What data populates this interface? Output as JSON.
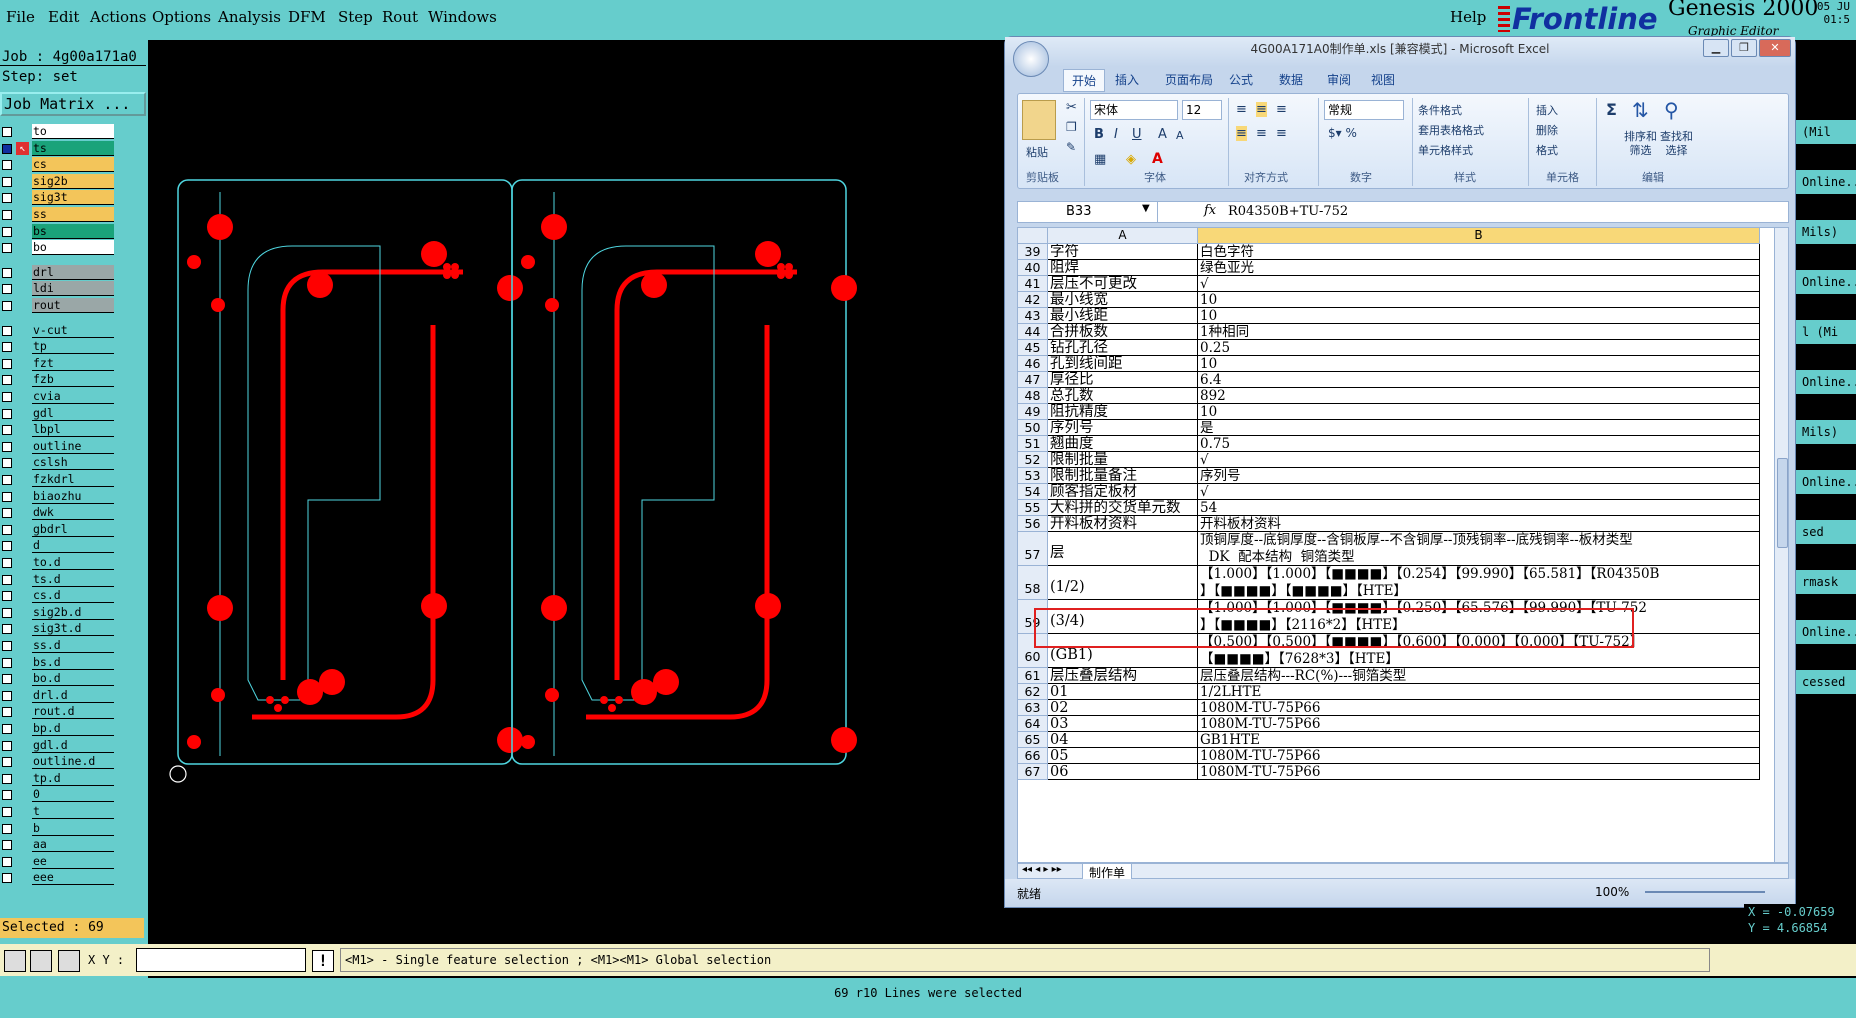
{
  "menu": {
    "items": [
      "File",
      "Edit",
      "Actions",
      "Options",
      "Analysis",
      "DFM",
      "Step",
      "Rout",
      "Windows"
    ],
    "help": "Help"
  },
  "brand": {
    "logo": "Frontline",
    "product": "Genesis 2000",
    "subtitle": "Graphic Editor",
    "date": "05 JU",
    "time": "01:5"
  },
  "job": {
    "job_line": "Job : 4g00a171a0",
    "step_line": "Step: set",
    "matrix_button": "Job Matrix ..."
  },
  "layers": [
    {
      "name": "to",
      "color": "#ffffff",
      "checked": false
    },
    {
      "name": "ts",
      "color": "#1aa37a",
      "checked": true
    },
    {
      "name": "cs",
      "color": "#f3c55a",
      "checked": false
    },
    {
      "name": "sig2b",
      "color": "#f3c55a",
      "checked": false
    },
    {
      "name": "sig3t",
      "color": "#f3c55a",
      "checked": false
    },
    {
      "name": "ss",
      "color": "#f3c55a",
      "checked": false
    },
    {
      "name": "bs",
      "color": "#1aa37a",
      "checked": false
    },
    {
      "name": "bo",
      "color": "#ffffff",
      "checked": false
    },
    {
      "name": "drl",
      "color": "#9aa7a7",
      "checked": false
    },
    {
      "name": "ldi",
      "color": "#9aa7a7",
      "checked": false
    },
    {
      "name": "rout",
      "color": "#9aa7a7",
      "checked": false
    },
    {
      "name": "v-cut",
      "color": "#66cdcc",
      "checked": false
    },
    {
      "name": "tp",
      "color": "#66cdcc",
      "checked": false
    },
    {
      "name": "fzt",
      "color": "#66cdcc",
      "checked": false
    },
    {
      "name": "fzb",
      "color": "#66cdcc",
      "checked": false
    },
    {
      "name": "cvia",
      "color": "#66cdcc",
      "checked": false
    },
    {
      "name": "gdl",
      "color": "#66cdcc",
      "checked": false
    },
    {
      "name": "lbpl",
      "color": "#66cdcc",
      "checked": false
    },
    {
      "name": "outline",
      "color": "#66cdcc",
      "checked": false
    },
    {
      "name": "cslsh",
      "color": "#66cdcc",
      "checked": false
    },
    {
      "name": "fzkdrl",
      "color": "#66cdcc",
      "checked": false
    },
    {
      "name": "biaozhu",
      "color": "#66cdcc",
      "checked": false
    },
    {
      "name": "dwk",
      "color": "#66cdcc",
      "checked": false
    },
    {
      "name": "gbdrl",
      "color": "#66cdcc",
      "checked": false
    },
    {
      "name": "d",
      "color": "#66cdcc",
      "checked": false
    },
    {
      "name": "to.d",
      "color": "#66cdcc",
      "checked": false
    },
    {
      "name": "ts.d",
      "color": "#66cdcc",
      "checked": false
    },
    {
      "name": "cs.d",
      "color": "#66cdcc",
      "checked": false
    },
    {
      "name": "sig2b.d",
      "color": "#66cdcc",
      "checked": false
    },
    {
      "name": "sig3t.d",
      "color": "#66cdcc",
      "checked": false
    },
    {
      "name": "ss.d",
      "color": "#66cdcc",
      "checked": false
    },
    {
      "name": "bs.d",
      "color": "#66cdcc",
      "checked": false
    },
    {
      "name": "bo.d",
      "color": "#66cdcc",
      "checked": false
    },
    {
      "name": "drl.d",
      "color": "#66cdcc",
      "checked": false
    },
    {
      "name": "rout.d",
      "color": "#66cdcc",
      "checked": false
    },
    {
      "name": "bp.d",
      "color": "#66cdcc",
      "checked": false
    },
    {
      "name": "gdl.d",
      "color": "#66cdcc",
      "checked": false
    },
    {
      "name": "outline.d",
      "color": "#66cdcc",
      "checked": false
    },
    {
      "name": "tp.d",
      "color": "#66cdcc",
      "checked": false
    },
    {
      "name": "0",
      "color": "#66cdcc",
      "checked": false
    },
    {
      "name": "t",
      "color": "#66cdcc",
      "checked": false
    },
    {
      "name": "b",
      "color": "#66cdcc",
      "checked": false
    },
    {
      "name": "aa",
      "color": "#66cdcc",
      "checked": false
    },
    {
      "name": "ee",
      "color": "#66cdcc",
      "checked": false
    },
    {
      "name": "eee",
      "color": "#66cdcc",
      "checked": false
    }
  ],
  "selected_label": "Selected : 69",
  "bottom": {
    "xy_label": "X Y :",
    "xy_value": "",
    "hint": "<M1> - Single feature selection ; <M1><M1> Global selection",
    "status": "69 r10 Lines were selected"
  },
  "coords": {
    "x": "X = -0.07659",
    "y": "Y = 4.66854"
  },
  "rightstrip": [
    "(Mil",
    "Online...",
    "Mils)",
    "Online...",
    "l (Mi",
    "Online...",
    "Mils)",
    "Online...",
    "sed",
    "rmask",
    "Online...",
    "cessed"
  ],
  "excel": {
    "title": "4G00A171A0制作单.xls [兼容模式] - Microsoft Excel",
    "tabs": [
      "开始",
      "插入",
      "页面布局",
      "公式",
      "数据",
      "审阅",
      "视图"
    ],
    "font_name": "宋体",
    "font_size": "12",
    "number_format": "常规",
    "groups": [
      "剪贴板",
      "字体",
      "对齐方式",
      "数字",
      "样式",
      "单元格",
      "编辑"
    ],
    "buttons": {
      "paste": "粘贴",
      "cond_format": "条件格式",
      "table_format": "套用表格格式",
      "cell_style": "单元格样式",
      "insert": "插入",
      "delete": "删除",
      "format": "格式",
      "sort": "排序和\n筛选",
      "find": "查找和\n选择"
    },
    "name_box": "B33",
    "formula": "R04350B+TU-752",
    "col_a": "A",
    "col_b": "B",
    "rows": [
      {
        "n": "39",
        "a": "字符",
        "b": "白色字符"
      },
      {
        "n": "40",
        "a": "阻焊",
        "b": "绿色亚光"
      },
      {
        "n": "41",
        "a": "层压不可更改",
        "b": "√"
      },
      {
        "n": "42",
        "a": "最小线宽",
        "b": "10"
      },
      {
        "n": "43",
        "a": "最小线距",
        "b": "10"
      },
      {
        "n": "44",
        "a": "合拼板数",
        "b": "1种相同"
      },
      {
        "n": "45",
        "a": "钻孔孔径",
        "b": "0.25"
      },
      {
        "n": "46",
        "a": "孔到线间距",
        "b": "10"
      },
      {
        "n": "47",
        "a": "厚径比",
        "b": "6.4"
      },
      {
        "n": "48",
        "a": "总孔数",
        "b": "892"
      },
      {
        "n": "49",
        "a": "阻抗精度",
        "b": "10"
      },
      {
        "n": "50",
        "a": "序列号",
        "b": "是"
      },
      {
        "n": "51",
        "a": "翘曲度",
        "b": "0.75"
      },
      {
        "n": "52",
        "a": "限制批量",
        "b": "√"
      },
      {
        "n": "53",
        "a": "限制批量备注",
        "b": "序列号"
      },
      {
        "n": "54",
        "a": "顾客指定板材",
        "b": "√"
      },
      {
        "n": "55",
        "a": "大料拼的交货单元数",
        "b": "54"
      },
      {
        "n": "56",
        "a": "开料板材资料",
        "b": "开料板材资料"
      },
      {
        "n": "57",
        "a": "层",
        "b": "顶铜厚度--底铜厚度--含铜板厚--不含铜厚--顶残铜率--底残铜率--板材类型\n  DK  配本结构  铜箔类型"
      },
      {
        "n": "58",
        "a": "(1/2)",
        "b": "【1.000】【1.000】【■■■■】【0.254】【99.990】【65.581】【R04350B\n】【■■■■】【■■■■】【HTE】"
      },
      {
        "n": "59",
        "a": "(3/4)",
        "b": "【1.000】【1.000】【■■■■】【0.250】【65.576】【99.990】【TU-752\n】【■■■■】【2116*2】【HTE】"
      },
      {
        "n": "60",
        "a": "(GB1)",
        "b": "【0.500】【0.500】【■■■■】【0.600】【0.000】【0.000】【TU-752】\n【■■■■】【7628*3】【HTE】"
      },
      {
        "n": "61",
        "a": "层压叠层结构",
        "b": "层压叠层结构---RC(%)---铜箔类型"
      },
      {
        "n": "62",
        "a": "01",
        "b": "1/2LHTE"
      },
      {
        "n": "63",
        "a": "02",
        "b": "1080M-TU-75P66"
      },
      {
        "n": "64",
        "a": "03",
        "b": "1080M-TU-75P66"
      },
      {
        "n": "65",
        "a": "04",
        "b": "GB1HTE"
      },
      {
        "n": "66",
        "a": "05",
        "b": "1080M-TU-75P66"
      },
      {
        "n": "67",
        "a": "06",
        "b": "1080M-TU-75P66"
      }
    ],
    "sheet_tab": "制作单",
    "status_ready": "就绪",
    "zoom": "100%"
  },
  "colors": {
    "cyan": "#66cdcc",
    "accent_red": "#ff0000",
    "outline": "#4fd6e0",
    "selection": "#e02020"
  }
}
